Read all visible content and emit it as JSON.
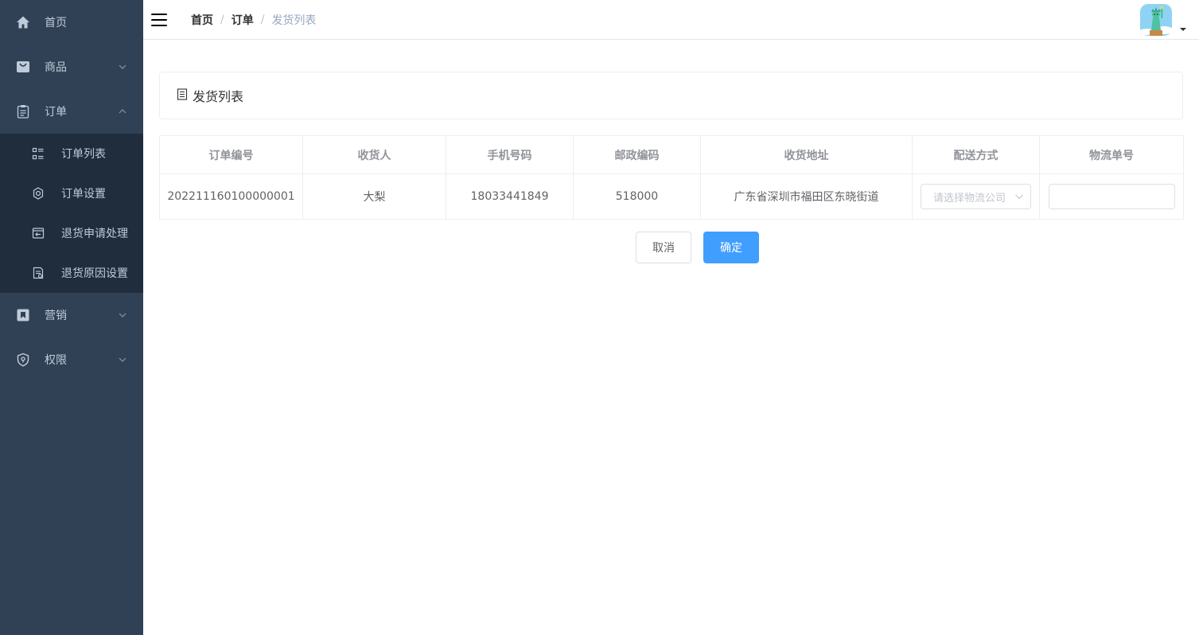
{
  "sidebar": {
    "items": [
      {
        "label": "首页",
        "icon": "home-icon"
      },
      {
        "label": "商品",
        "icon": "shopping-bag-icon",
        "expanded": false
      },
      {
        "label": "订单",
        "icon": "clipboard-icon",
        "expanded": true
      },
      {
        "label": "营销",
        "icon": "bookmark-icon",
        "expanded": false
      },
      {
        "label": "权限",
        "icon": "shield-icon",
        "expanded": false
      }
    ],
    "order_submenu": [
      {
        "label": "订单列表",
        "icon": "list-icon"
      },
      {
        "label": "订单设置",
        "icon": "gear-icon"
      },
      {
        "label": "退货申请处理",
        "icon": "return-icon"
      },
      {
        "label": "退货原因设置",
        "icon": "document-icon"
      }
    ]
  },
  "header": {
    "breadcrumb": [
      "首页",
      "订单",
      "发货列表"
    ],
    "separator": "/"
  },
  "card": {
    "title": "发货列表",
    "icon": "document-icon"
  },
  "table": {
    "columns": [
      "订单编号",
      "收货人",
      "手机号码",
      "邮政编码",
      "收货地址",
      "配送方式",
      "物流单号"
    ],
    "rows": [
      {
        "order_no": "202211160100000001",
        "receiver": "大梨",
        "phone": "18033441849",
        "postcode": "518000",
        "address": "广东省深圳市福田区东晓街道",
        "delivery_placeholder": "请选择物流公司",
        "tracking_no": ""
      }
    ]
  },
  "actions": {
    "cancel": "取消",
    "confirm": "确定"
  },
  "colors": {
    "sidebar_bg": "#304156",
    "submenu_bg": "#1f2d3d",
    "primary": "#409eff"
  }
}
